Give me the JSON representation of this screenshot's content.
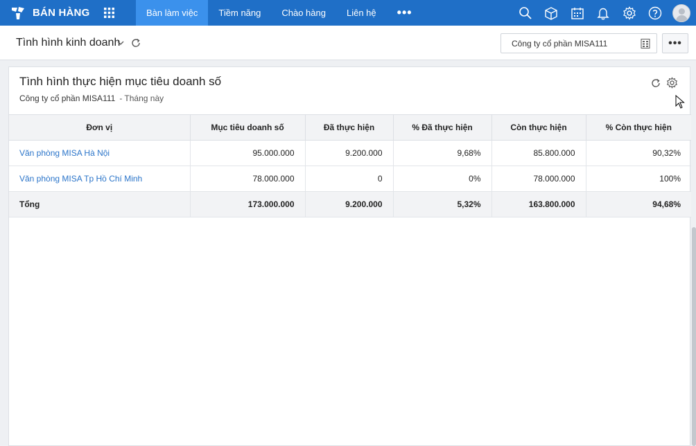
{
  "app": {
    "name": "BÁN HÀNG"
  },
  "nav": {
    "items": [
      {
        "label": "Bàn làm việc",
        "active": true
      },
      {
        "label": "Tiềm năng",
        "active": false
      },
      {
        "label": "Chào hàng",
        "active": false
      },
      {
        "label": "Liên hệ",
        "active": false
      }
    ],
    "more": "•••"
  },
  "toolbar_icons": [
    "search-icon",
    "box-icon",
    "calendar-icon",
    "bell-icon",
    "gear-icon",
    "help-icon",
    "avatar"
  ],
  "header": {
    "title": "Tình hình kinh doanh",
    "company": "Công ty cổ phần MISA111",
    "more": "•••"
  },
  "widget": {
    "title": "Tình hình thực hiện mục tiêu doanh số",
    "company": "Công ty cổ phần MISA111",
    "period": "- Tháng này",
    "columns": [
      "Đơn vị",
      "Mục tiêu doanh số",
      "Đã thực hiện",
      "% Đã thực hiện",
      "Còn thực hiện",
      "% Còn thực hiện"
    ],
    "rows": [
      [
        "Văn phòng MISA Hà Nội",
        "95.000.000",
        "9.200.000",
        "9,68%",
        "85.800.000",
        "90,32%"
      ],
      [
        "Văn phòng MISA Tp Hồ Chí Minh",
        "78.000.000",
        "0",
        "0%",
        "78.000.000",
        "100%"
      ]
    ],
    "total": [
      "Tổng",
      "173.000.000",
      "9.200.000",
      "5,32%",
      "163.800.000",
      "94,68%"
    ]
  },
  "colors": {
    "primary": "#1f6fc7",
    "nav_active": "#3b91ec",
    "link": "#2a74c9",
    "header_bg": "#f2f3f5"
  }
}
